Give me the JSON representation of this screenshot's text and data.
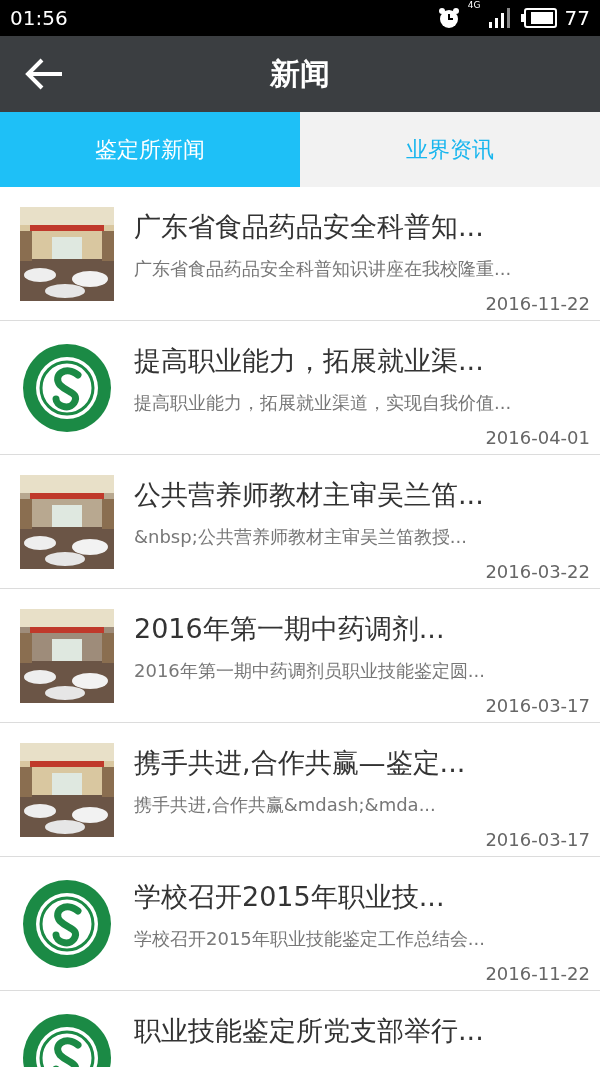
{
  "status_bar": {
    "time": "01:56",
    "network": "4G",
    "battery": "77"
  },
  "header": {
    "title": "新闻"
  },
  "tabs": [
    {
      "label": "鉴定所新闻",
      "selected": true
    },
    {
      "label": "业界资讯",
      "selected": false
    }
  ],
  "news": [
    {
      "kind": "picture",
      "title": "广东省食品药品安全科普知...",
      "summary": "广东省食品药品安全科普知识讲座在我校隆重...",
      "date": "2016-11-22"
    },
    {
      "kind": "logo",
      "title": "提高职业能力，拓展就业渠...",
      "summary": "提高职业能力，拓展就业渠道，实现自我价值...",
      "date": "2016-04-01"
    },
    {
      "kind": "picture",
      "title": "公共营养师教材主审吴兰笛...",
      "summary": "&nbsp;公共营养师教材主审吴兰笛教授...",
      "date": "2016-03-22"
    },
    {
      "kind": "picture",
      "title": "2016年第一期中药调剂...",
      "summary": "2016年第一期中药调剂员职业技能鉴定圆...",
      "date": "2016-03-17"
    },
    {
      "kind": "picture",
      "title": "携手共进,合作共赢—鉴定...",
      "summary": "携手共进,合作共赢&mdash;&mda...",
      "date": "2016-03-17"
    },
    {
      "kind": "logo",
      "title": "学校召开2015年职业技...",
      "summary": "学校召开2015年职业技能鉴定工作总结会...",
      "date": "2016-11-22"
    },
    {
      "kind": "logo",
      "title": "职业技能鉴定所党支部举行..."
    }
  ]
}
